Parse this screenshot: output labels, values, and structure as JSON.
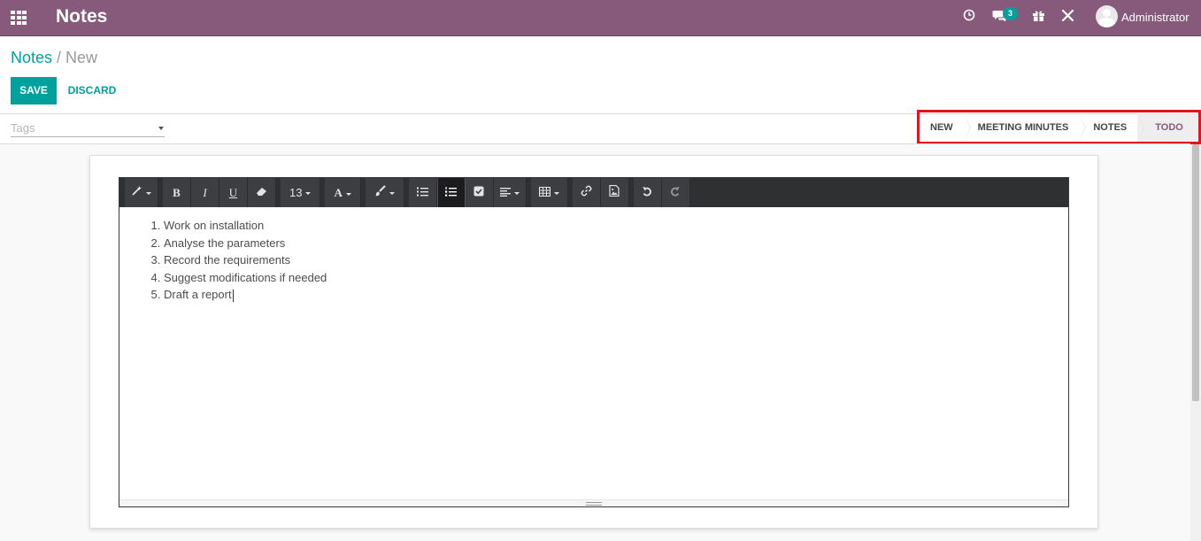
{
  "navbar": {
    "app_title": "Notes",
    "chat_badge": "3",
    "user_name": "Administrator",
    "bg_color": "#875a7b",
    "icons": [
      "apps-icon",
      "clock-icon",
      "chat-icon",
      "gift-icon",
      "tools-icon",
      "avatar"
    ]
  },
  "breadcrumb": {
    "parent": "Notes",
    "separator": "/",
    "current": "New"
  },
  "actions": {
    "save_label": "SAVE",
    "discard_label": "DISCARD",
    "accent_color": "#00a09d"
  },
  "tags": {
    "placeholder": "Tags"
  },
  "statusbar": {
    "stages": [
      {
        "label": "NEW",
        "active": false
      },
      {
        "label": "MEETING MINUTES",
        "active": false
      },
      {
        "label": "NOTES",
        "active": false
      },
      {
        "label": "TODO",
        "active": true
      }
    ],
    "highlight_color": "#e3141e"
  },
  "editor": {
    "toolbar": {
      "font_size": "13",
      "bold_label": "B",
      "italic_label": "I",
      "underline_label": "U",
      "font_color_label": "A"
    },
    "items": [
      "Work on installation",
      "Analyse the parameters",
      "Record the requirements",
      "Suggest modifications if needed",
      "Draft a report"
    ]
  }
}
